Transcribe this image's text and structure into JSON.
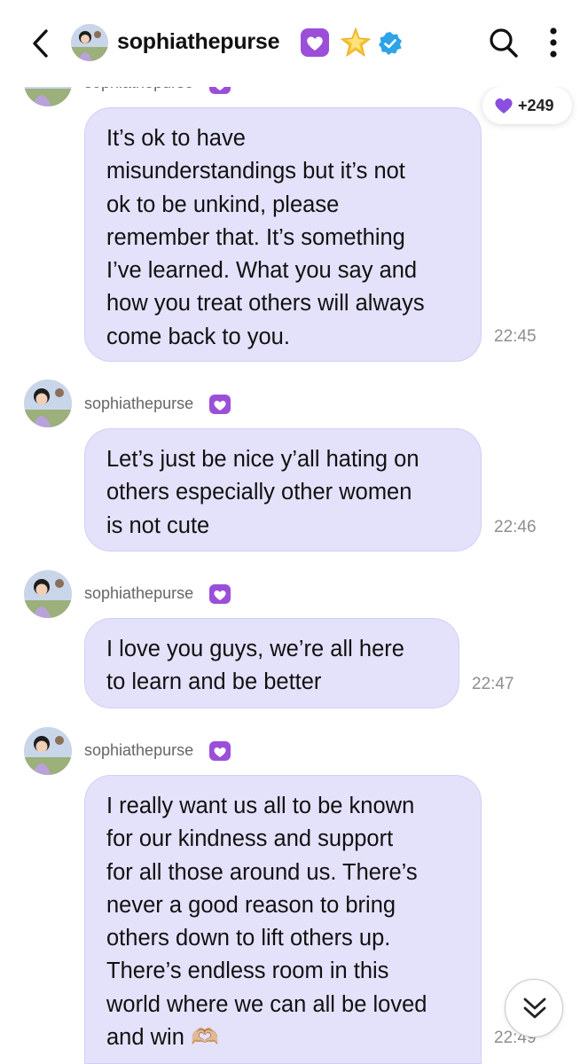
{
  "header": {
    "username": "sophiathepurse",
    "icons": [
      "back-chevron-icon",
      "purple-heart-icon",
      "star-icon",
      "verified-badge-icon",
      "search-icon",
      "more-vertical-icon"
    ],
    "colors": {
      "verified": "#2da3e8",
      "heart": "#9b4fd9",
      "star": "#f6c531"
    }
  },
  "reaction": {
    "count": "+249",
    "icon": "purple-heart-icon"
  },
  "messages": [
    {
      "sender": "sophiathepurse",
      "text": "It’s ok to have\nmisunderstandings but it’s not\nok to be unkind, please\nremember that. It’s something\nI’ve learned. What you say and\nhow you treat others will always\ncome back to you.",
      "time": "22:45"
    },
    {
      "sender": "sophiathepurse",
      "text": "Let’s just be nice y’all hating on\nothers especially other women\nis not cute",
      "time": "22:46"
    },
    {
      "sender": "sophiathepurse",
      "text": "I love you guys, we’re all here\nto learn and be better",
      "time": "22:47"
    },
    {
      "sender": "sophiathepurse",
      "text": "I really want us all to be known\nfor our kindness and support\nfor all those around us. There’s\nnever a good reason to bring\nothers down to lift others up.\nThere’s endless room in this\nworld where we can all be loved\nand win 🫶🏼",
      "time": "22:49"
    }
  ],
  "bubble_color": "#e4e1fb"
}
